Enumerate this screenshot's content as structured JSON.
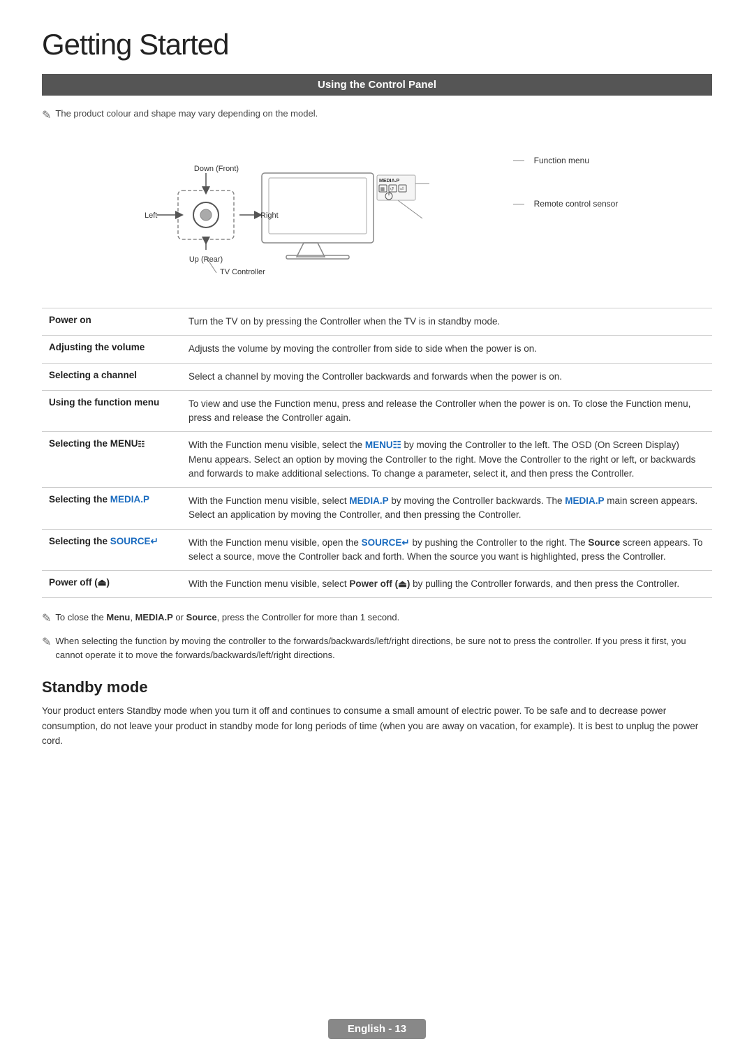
{
  "page": {
    "title": "Getting Started",
    "section_title": "Using the Control Panel",
    "note_model": "The product colour and shape may vary depending on the model.",
    "footer_label": "English - 13"
  },
  "diagram": {
    "labels": {
      "down_front": "Down (Front)",
      "left": "Left",
      "right": "Right",
      "up_rear": "Up (Rear)",
      "tv_controller": "TV Controller",
      "function_menu": "Function menu",
      "remote_sensor": "Remote control sensor",
      "media_p": "MEDIA.P"
    }
  },
  "table": {
    "rows": [
      {
        "label": "Power on",
        "description": "Turn the TV on by pressing the Controller when the TV is in standby mode."
      },
      {
        "label": "Adjusting the volume",
        "description": "Adjusts the volume by moving the controller from side to side when the power is on."
      },
      {
        "label": "Selecting a channel",
        "description": "Select a channel by moving the Controller backwards and forwards when the power is on."
      },
      {
        "label": "Using the function menu",
        "description": "To view and use the Function menu, press and release the Controller when the power is on. To close the Function menu, press and release the Controller again."
      },
      {
        "label": "Selecting the MENU",
        "label_suffix": "☰",
        "description": "With the Function menu visible, select the MENU☰ by moving the Controller to the left. The OSD (On Screen Display) Menu appears. Select an option by moving the Controller to the right. Move the Controller to the right or left, or backwards and forwards to make additional selections. To change a parameter, select it, and then press the Controller."
      },
      {
        "label": "Selecting the MEDIA.P",
        "description_prefix": "With the Function menu visible, select ",
        "description_highlight": "MEDIA.P",
        "description_suffix": " by moving the Controller backwards. The MEDIA.P main screen appears. Select an application by moving the Controller, and then pressing the Controller."
      },
      {
        "label": "Selecting the SOURCE",
        "label_suffix": "⏎",
        "description": "With the Function menu visible, open the SOURCE⏎ by pushing the Controller to the right. The Source screen appears. To select a source, move the Controller back and forth. When the source you want is highlighted, press the Controller."
      },
      {
        "label": "Power off (⏻)",
        "description": "With the Function menu visible, select Power off (⏻) by pulling the Controller forwards, and then press the Controller."
      }
    ]
  },
  "notes": [
    "To close the Menu, MEDIA.P or Source, press the Controller for more than 1 second.",
    "When selecting the function by moving the controller to the forwards/backwards/left/right directions, be sure not to press the controller. If you press it first, you cannot operate it to move the forwards/backwards/left/right directions."
  ],
  "standby": {
    "heading": "Standby mode",
    "body": "Your product enters Standby mode when you turn it off and continues to consume a small amount of electric power. To be safe and to decrease power consumption, do not leave your product in standby mode for long periods of time (when you are away on vacation, for example). It is best to unplug the power cord."
  }
}
